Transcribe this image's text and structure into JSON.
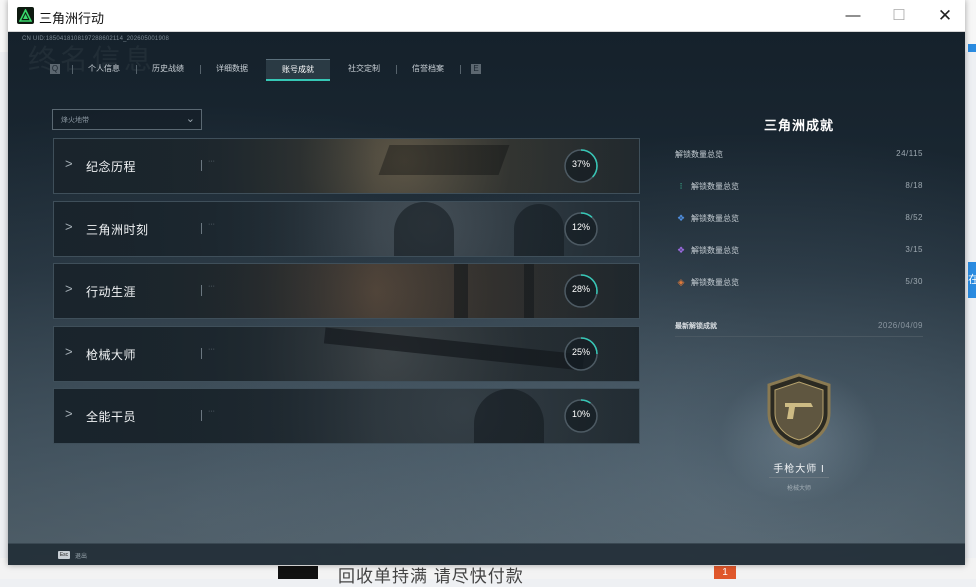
{
  "window": {
    "title": "三角洲行动",
    "minimize_glyph": "—",
    "maximize_glyph": "☐",
    "close_glyph": "✕"
  },
  "desktop": {
    "right_tab_char": "在",
    "bottom_badge": "1",
    "bottom_text": "回收单持满  请尽快付款"
  },
  "game": {
    "uid_text": "CN UID:1850418108197288602114_202605001908",
    "ghost_heading": "终名信息",
    "tabs": [
      {
        "label": "个人信息"
      },
      {
        "label": "历史战绩"
      },
      {
        "label": "详细数据"
      },
      {
        "label": "账号成就",
        "active": true
      },
      {
        "label": "社交定制"
      },
      {
        "label": "信誉档案"
      }
    ],
    "tab_prev_glyph": "Q",
    "tab_next_glyph": "E",
    "filter": {
      "value": "烽火地带",
      "chevron": "⌄"
    },
    "categories": [
      {
        "label": "纪念历程",
        "percent": 37,
        "percent_label": "37%"
      },
      {
        "label": "三角洲时刻",
        "percent": 12,
        "percent_label": "12%"
      },
      {
        "label": "行动生涯",
        "percent": 28,
        "percent_label": "28%"
      },
      {
        "label": "枪械大师",
        "percent": 25,
        "percent_label": "25%"
      },
      {
        "label": "全能干员",
        "percent": 10,
        "percent_label": "10%"
      }
    ],
    "category_chevron": ">",
    "category_dots": "···",
    "summary": {
      "title": "三角洲成就",
      "total_label": "解锁数量总览",
      "total_value": "24/115",
      "rows": [
        {
          "icon": "green-tier-icon",
          "icon_color": "#3fc59a",
          "label": "解锁数量总览",
          "value": "8/18"
        },
        {
          "icon": "blue-tier-icon",
          "icon_color": "#4f8fe0",
          "label": "解锁数量总览",
          "value": "8/52"
        },
        {
          "icon": "purple-tier-icon",
          "icon_color": "#9b6ae0",
          "label": "解锁数量总览",
          "value": "3/15"
        },
        {
          "icon": "orange-tier-icon",
          "icon_color": "#e07a3a",
          "label": "解锁数量总览",
          "value": "5/30"
        }
      ],
      "latest_label": "最新解锁成就",
      "latest_date": "2026/04/09",
      "latest_badge_name": "手枪大师 I",
      "latest_badge_category": "枪械大师"
    },
    "footer": {
      "esc_key": "Esc",
      "esc_label": "退出"
    },
    "accent_color": "#36c7b6"
  }
}
